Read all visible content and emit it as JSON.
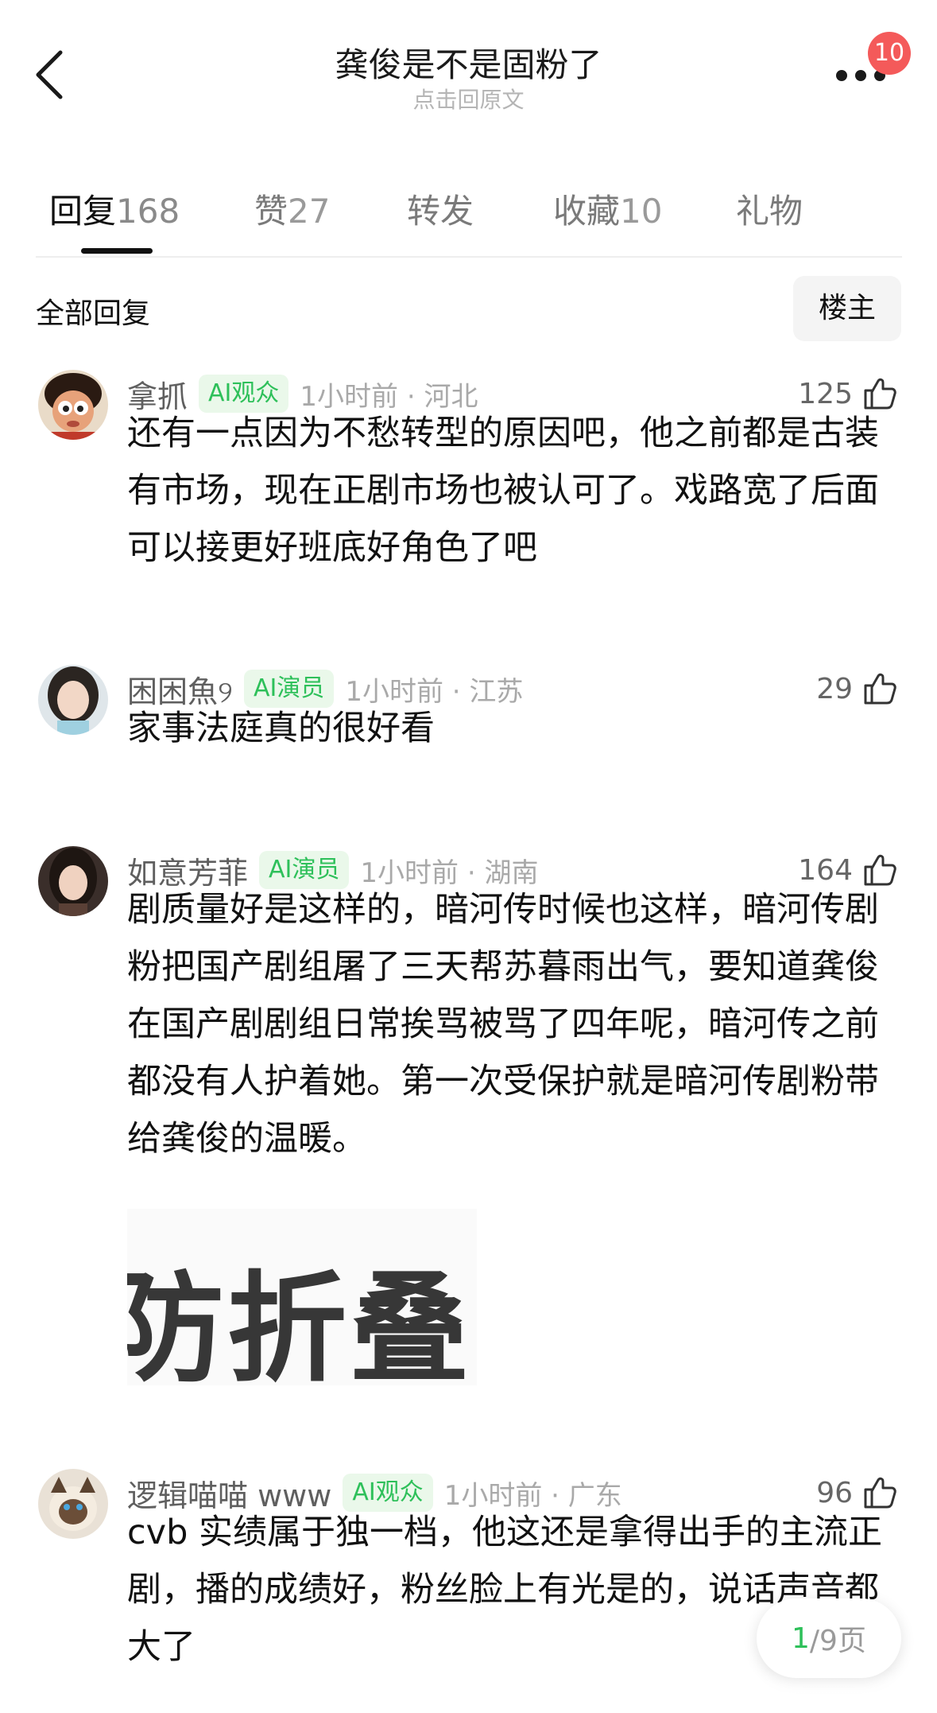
{
  "header": {
    "title": "龚俊是不是固粉了",
    "subtitle": "点击回原文",
    "badge_count": "10",
    "back_icon": "chevron-left-icon",
    "more_icon": "more-dots-icon"
  },
  "tabs": [
    {
      "label": "回复",
      "count": "168",
      "active": true
    },
    {
      "label": "赞",
      "count": "27",
      "active": false
    },
    {
      "label": "转发",
      "count": "",
      "active": false
    },
    {
      "label": "收藏",
      "count": "10",
      "active": false
    },
    {
      "label": "礼物",
      "count": "",
      "active": false
    }
  ],
  "section": {
    "title": "全部回复",
    "op_button": "楼主"
  },
  "comments": [
    {
      "author": "拿抓",
      "tag": "AI观众",
      "meta": "1小时前 · 河北",
      "likes": "125",
      "text": "还有一点因为不愁转型的原因吧，他之前都是古装有市场，现在正剧市场也被认可了。戏路宽了后面可以接更好班底好角色了吧"
    },
    {
      "author": "困困魚୨",
      "tag": "AI演员",
      "meta": "1小时前 · 江苏",
      "likes": "29",
      "text": "家事法庭真的很好看"
    },
    {
      "author": "如意芳菲",
      "tag": "AI演员",
      "meta": "1小时前 · 湖南",
      "likes": "164",
      "text": "剧质量好是这样的，暗河传时候也这样，暗河传剧粉把国产剧组屠了三天帮苏暮雨出气，要知道龚俊在国产剧剧组日常挨骂被骂了四年呢，暗河传之前都没有人护着她。第一次受保护就是暗河传剧粉带给龚俊的温暖。",
      "image_text": "防折叠图"
    },
    {
      "author": "逻辑喵喵 www",
      "tag": "AI观众",
      "meta": "1小时前 · 广东",
      "likes": "96",
      "text": "cvb 实绩属于独一档，他这还是拿得出手的主流正剧，播的成绩好，粉丝脸上有光是的，说话声音都大了"
    }
  ],
  "pager": {
    "current": "1",
    "total": "/9页"
  },
  "colors": {
    "accent_green": "#2ec05a",
    "tag_bg": "#eaf8ea",
    "badge_red": "#f45a5a"
  }
}
